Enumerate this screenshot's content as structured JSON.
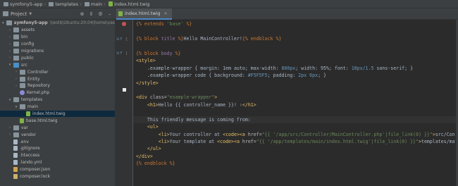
{
  "breadcrumb": [
    "symfony5-app",
    "templates",
    "main",
    "index.html.twig"
  ],
  "project_panel": {
    "title": "Project",
    "tools": [
      "globe-icon",
      "split-icon",
      "gear-icon",
      "minimize-icon"
    ]
  },
  "tree": [
    {
      "level": 0,
      "arrow": "▾",
      "icon": "folder",
      "label": "symfony5-app",
      "hint": "\\\\wsl$\\Ubuntu-20.04\\home\\vas",
      "bold": true
    },
    {
      "level": 1,
      "arrow": "›",
      "icon": "folder",
      "label": "assets"
    },
    {
      "level": 1,
      "arrow": "›",
      "icon": "folder",
      "label": "bin"
    },
    {
      "level": 1,
      "arrow": "›",
      "icon": "folder",
      "label": "config"
    },
    {
      "level": 1,
      "arrow": "›",
      "icon": "folder",
      "label": "migrations"
    },
    {
      "level": 1,
      "arrow": "›",
      "icon": "folder",
      "label": "public"
    },
    {
      "level": 1,
      "arrow": "▾",
      "icon": "folder blue",
      "label": "src"
    },
    {
      "level": 2,
      "arrow": "›",
      "icon": "folder",
      "label": "Controller"
    },
    {
      "level": 2,
      "arrow": "›",
      "icon": "folder",
      "label": "Entity"
    },
    {
      "level": 2,
      "arrow": "›",
      "icon": "folder",
      "label": "Repository"
    },
    {
      "level": 2,
      "arrow": "",
      "icon": "file-php",
      "label": "Kernel.php"
    },
    {
      "level": 1,
      "arrow": "▾",
      "icon": "folder",
      "label": "templates"
    },
    {
      "level": 2,
      "arrow": "▾",
      "icon": "folder",
      "label": "main"
    },
    {
      "level": 3,
      "arrow": "",
      "icon": "file-twig",
      "label": "index.html.twig",
      "selected": true
    },
    {
      "level": 2,
      "arrow": "",
      "icon": "file-twig",
      "label": "base.html.twig"
    },
    {
      "level": 1,
      "arrow": "›",
      "icon": "folder",
      "label": "var"
    },
    {
      "level": 1,
      "arrow": "›",
      "icon": "folder",
      "label": "vendor"
    },
    {
      "level": 1,
      "arrow": "",
      "icon": "file-generic",
      "label": ".env"
    },
    {
      "level": 1,
      "arrow": "",
      "icon": "file-generic",
      "label": ".gitignore"
    },
    {
      "level": 1,
      "arrow": "",
      "icon": "file-generic",
      "label": ".htaccess"
    },
    {
      "level": 1,
      "arrow": "",
      "icon": "file-generic",
      "label": ".lando.yml"
    },
    {
      "level": 1,
      "arrow": "",
      "icon": "file-json",
      "label": "composer.json"
    },
    {
      "level": 1,
      "arrow": "",
      "icon": "file-lock",
      "label": "composer.lock"
    }
  ],
  "editor": {
    "tab_label": "index.html.twig",
    "caret_line": 13,
    "lines": [
      [
        [
          "k",
          "{% extends "
        ],
        [
          "s",
          "'base'"
        ],
        [
          "k",
          " %}"
        ]
      ],
      [],
      [
        [
          "k",
          "{% block "
        ],
        [
          "v",
          "title"
        ],
        [
          "k",
          " %}"
        ],
        [
          "",
          "Hello MainController!"
        ],
        [
          "k",
          "{% endblock %}"
        ]
      ],
      [],
      [
        [
          "k",
          "{% block "
        ],
        [
          "v",
          "body"
        ],
        [
          "k",
          " %}"
        ]
      ],
      [
        [
          "t",
          "<style>"
        ]
      ],
      [
        [
          "",
          "    .example-wrapper { margin: 1em auto; max-width: "
        ],
        [
          "n",
          "800px"
        ],
        [
          "",
          "; width: 95%; font: "
        ],
        [
          "n",
          "18px/1.5"
        ],
        [
          "",
          " sans-serif; }"
        ]
      ],
      [
        [
          "",
          "    .example-wrapper code { background: "
        ],
        [
          "n",
          "#F5F5F5"
        ],
        [
          "",
          "; padding: "
        ],
        [
          "n",
          "2px 6px"
        ],
        [
          "",
          "; }"
        ]
      ],
      [
        [
          "t",
          "</style>"
        ]
      ],
      [],
      [
        [
          "t",
          "<div "
        ],
        [
          "a",
          "class="
        ],
        [
          "s",
          "\"example-wrapper\""
        ],
        [
          "t",
          ">"
        ]
      ],
      [
        [
          "",
          "    "
        ],
        [
          "t",
          "<h1>"
        ],
        [
          "",
          "Hello {{ controller_name }}! "
        ],
        [
          "c",
          "✌"
        ],
        [
          "t",
          "</h1>"
        ]
      ],
      [],
      [
        [
          "",
          "    This friendly message is coming from:"
        ]
      ],
      [
        [
          "",
          "    "
        ],
        [
          "t",
          "<ul>"
        ]
      ],
      [
        [
          "",
          "        "
        ],
        [
          "t",
          "<li>"
        ],
        [
          "",
          "Your controller at "
        ],
        [
          "t",
          "<code><a "
        ],
        [
          "a",
          "href="
        ],
        [
          "s",
          "\"{{ '/app/src/Controller/MainController.php'|file_link(0) }}\""
        ],
        [
          "t",
          ">"
        ],
        [
          "",
          "src/Con"
        ]
      ],
      [
        [
          "",
          "        "
        ],
        [
          "t",
          "<li>"
        ],
        [
          "",
          "Your template at "
        ],
        [
          "t",
          "<code><a "
        ],
        [
          "a",
          "href="
        ],
        [
          "s",
          "\"{{ '/app/templates/main/index.html.twig'|file_link(0) }}\""
        ],
        [
          "t",
          ">"
        ],
        [
          "",
          "templates/ma"
        ]
      ],
      [
        [
          "",
          "    "
        ],
        [
          "t",
          "</ul>"
        ]
      ],
      [
        [
          "t",
          "</div>"
        ]
      ],
      [
        [
          "k",
          "{% endblock %}"
        ]
      ]
    ]
  },
  "colors": {
    "panel_bg": "#3c3f41",
    "editor_bg": "#2b2b2b",
    "selection": "#0d293e",
    "tab_underline": "#4a88c7",
    "keyword": "#cc7832",
    "string": "#6a8759",
    "tag": "#e8bf6a",
    "number": "#6897bb"
  }
}
